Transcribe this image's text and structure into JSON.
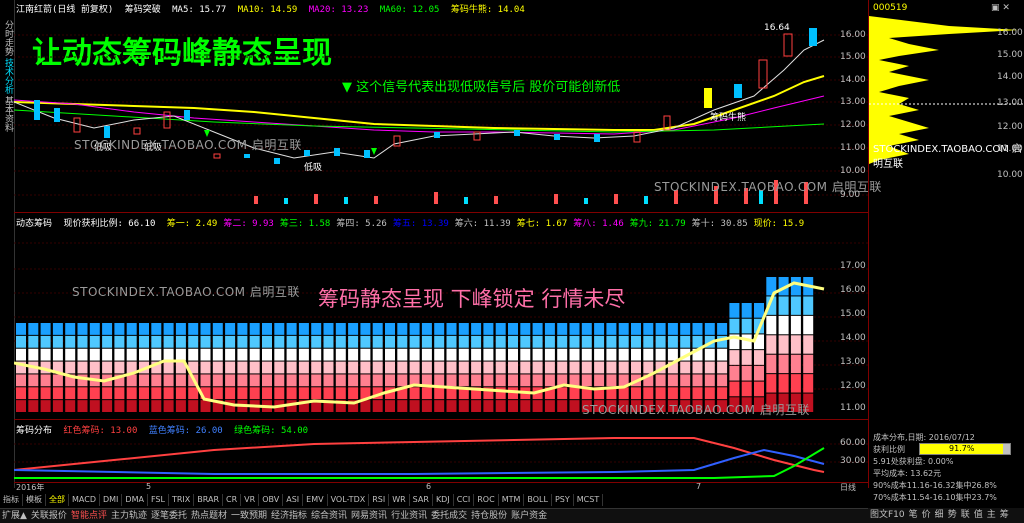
{
  "left_tabs": [
    "分时走势",
    "技术分析",
    "基本资料"
  ],
  "top_header": {
    "title": "江南红箭(日线 前复权)",
    "indicator": "筹码突破",
    "ma5": "MA5: 15.77",
    "ma10": "MA10: 14.59",
    "ma20": "MA20: 13.23",
    "ma60": "MA60: 12.05",
    "chip": "筹码牛熊: 14.04"
  },
  "banner_title": "让动态筹码峰静态呈现",
  "banner_note": "▼ 这个信号代表出现低吸信号后 股价可能创新低",
  "price_labels": {
    "high": "16.64",
    "low": "低吸",
    "low2": "低吸",
    "mid": "低吸",
    "chip_tag": "筹码牛熊"
  },
  "price_axis": [
    "16.00",
    "15.00",
    "14.00",
    "13.00",
    "12.00",
    "11.00",
    "10.00",
    "9.00"
  ],
  "watermark": "STOCKINDEX.TAOBAO.COM 启明互联",
  "mid_header": {
    "name": "动态筹码",
    "ratio": "现价获利比例: 66.10",
    "items": [
      {
        "label": "筹一: 2.49",
        "color": "#ffff00"
      },
      {
        "label": "筹二: 9.93",
        "color": "#ff00ff"
      },
      {
        "label": "筹三: 1.58",
        "color": "#00ff00"
      },
      {
        "label": "筹四: 5.26",
        "color": "#c0c0c0"
      },
      {
        "label": "筹五: 13.39",
        "color": "#0000ff"
      },
      {
        "label": "筹六: 11.39",
        "color": "#c0c0c0"
      },
      {
        "label": "筹七: 1.67",
        "color": "#ffff00"
      },
      {
        "label": "筹八: 1.46",
        "color": "#ff00ff"
      },
      {
        "label": "筹九: 21.79",
        "color": "#00ff00"
      },
      {
        "label": "筹十: 30.85",
        "color": "#c0c0c0"
      },
      {
        "label": "现价: 15.9",
        "color": "#ffff00"
      }
    ]
  },
  "mid_banner": "筹码静态呈现 下峰锁定 行情未尽",
  "mid_axis": [
    "17.00",
    "16.00",
    "15.00",
    "14.00",
    "13.00",
    "12.00",
    "11.00"
  ],
  "bottom_header": {
    "name": "筹码分布",
    "red": "红色筹码: 13.00",
    "blue": "蓝色筹码: 26.00",
    "green": "绿色筹码: 54.00"
  },
  "bottom_axis": [
    "60.00",
    "30.00"
  ],
  "date_axis": {
    "year": "2016年",
    "m5": "5",
    "m6": "6",
    "m7": "7",
    "period": "日线"
  },
  "indicator_tabs": [
    "指标",
    "模板",
    "全部",
    "MACD",
    "DMI",
    "DMA",
    "FSL",
    "TRIX",
    "BRAR",
    "CR",
    "VR",
    "OBV",
    "ASI",
    "EMV",
    "VOL-TDX",
    "RSI",
    "WR",
    "SAR",
    "KDJ",
    "CCI",
    "ROC",
    "MTM",
    "BOLL",
    "PSY",
    "MCST"
  ],
  "bottom_tabs": [
    "扩展▲",
    "关联报价",
    "智能点评",
    "主力轨迹",
    "逐笔委托",
    "热点题材",
    "一致预期",
    "经济指标",
    "综合资讯",
    "网易资讯",
    "行业资讯",
    "委托成交",
    "持仓股份",
    "账户资金"
  ],
  "right_panel": {
    "code": "000519",
    "axis": [
      "16.00",
      "15.00",
      "14.00",
      "13.00",
      "12.00",
      "11.00",
      "10.00"
    ],
    "date": "成本分布,日期: 2016/07/12",
    "ratio_label": "获利比例",
    "ratio_value": "91.7%",
    "profit": "5.91处获利盘: 0.00%",
    "avg": "平均成本: 13.62元",
    "c90": "90%成本11.16-16.32集中26.8%",
    "c70": "70%成本11.54-16.10集中23.7%",
    "foot_tabs": [
      "图文F10",
      "笔",
      "价",
      "细",
      "势",
      "联",
      "值",
      "主",
      "筹"
    ]
  }
}
